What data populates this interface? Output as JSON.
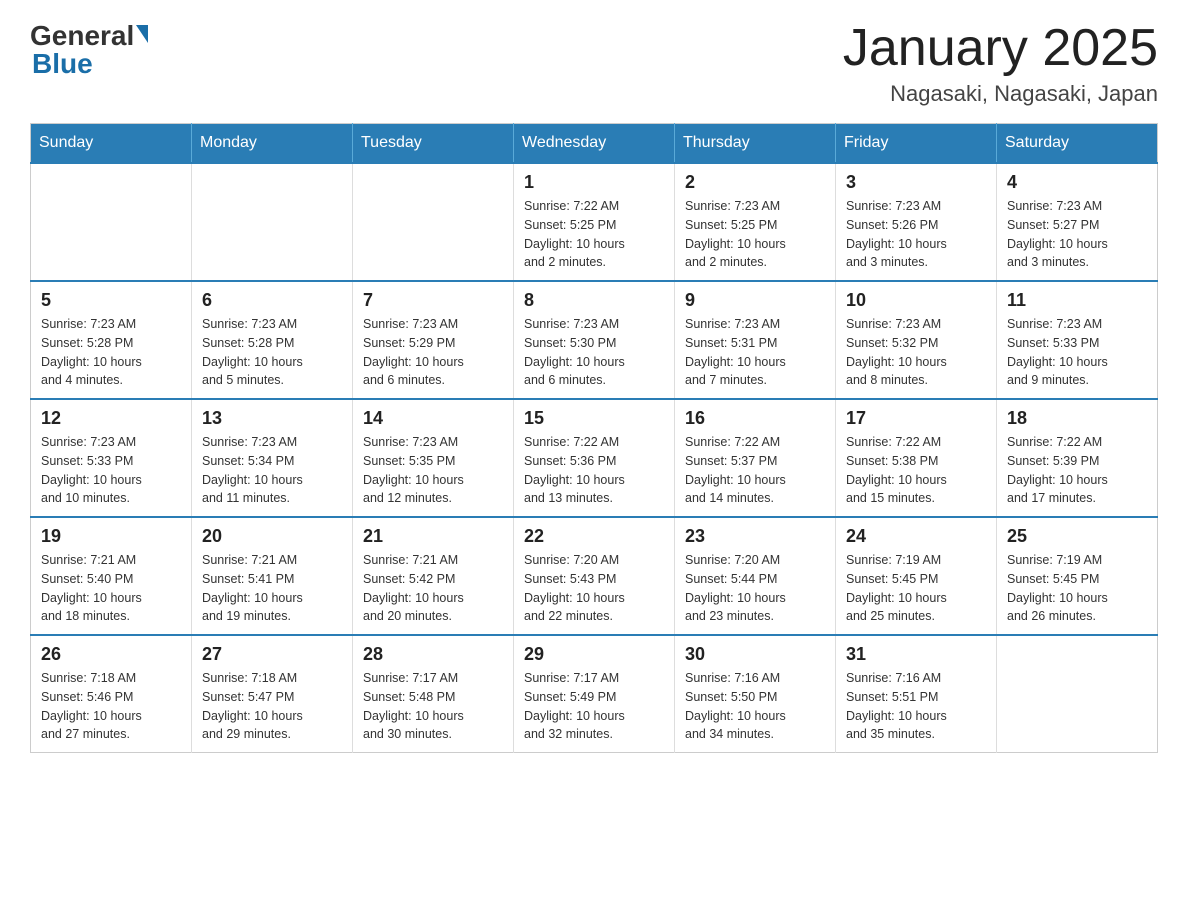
{
  "header": {
    "logo_general": "General",
    "logo_blue": "Blue",
    "month_title": "January 2025",
    "location": "Nagasaki, Nagasaki, Japan"
  },
  "days_of_week": [
    "Sunday",
    "Monday",
    "Tuesday",
    "Wednesday",
    "Thursday",
    "Friday",
    "Saturday"
  ],
  "weeks": [
    [
      {
        "day": "",
        "info": ""
      },
      {
        "day": "",
        "info": ""
      },
      {
        "day": "",
        "info": ""
      },
      {
        "day": "1",
        "info": "Sunrise: 7:22 AM\nSunset: 5:25 PM\nDaylight: 10 hours\nand 2 minutes."
      },
      {
        "day": "2",
        "info": "Sunrise: 7:23 AM\nSunset: 5:25 PM\nDaylight: 10 hours\nand 2 minutes."
      },
      {
        "day": "3",
        "info": "Sunrise: 7:23 AM\nSunset: 5:26 PM\nDaylight: 10 hours\nand 3 minutes."
      },
      {
        "day": "4",
        "info": "Sunrise: 7:23 AM\nSunset: 5:27 PM\nDaylight: 10 hours\nand 3 minutes."
      }
    ],
    [
      {
        "day": "5",
        "info": "Sunrise: 7:23 AM\nSunset: 5:28 PM\nDaylight: 10 hours\nand 4 minutes."
      },
      {
        "day": "6",
        "info": "Sunrise: 7:23 AM\nSunset: 5:28 PM\nDaylight: 10 hours\nand 5 minutes."
      },
      {
        "day": "7",
        "info": "Sunrise: 7:23 AM\nSunset: 5:29 PM\nDaylight: 10 hours\nand 6 minutes."
      },
      {
        "day": "8",
        "info": "Sunrise: 7:23 AM\nSunset: 5:30 PM\nDaylight: 10 hours\nand 6 minutes."
      },
      {
        "day": "9",
        "info": "Sunrise: 7:23 AM\nSunset: 5:31 PM\nDaylight: 10 hours\nand 7 minutes."
      },
      {
        "day": "10",
        "info": "Sunrise: 7:23 AM\nSunset: 5:32 PM\nDaylight: 10 hours\nand 8 minutes."
      },
      {
        "day": "11",
        "info": "Sunrise: 7:23 AM\nSunset: 5:33 PM\nDaylight: 10 hours\nand 9 minutes."
      }
    ],
    [
      {
        "day": "12",
        "info": "Sunrise: 7:23 AM\nSunset: 5:33 PM\nDaylight: 10 hours\nand 10 minutes."
      },
      {
        "day": "13",
        "info": "Sunrise: 7:23 AM\nSunset: 5:34 PM\nDaylight: 10 hours\nand 11 minutes."
      },
      {
        "day": "14",
        "info": "Sunrise: 7:23 AM\nSunset: 5:35 PM\nDaylight: 10 hours\nand 12 minutes."
      },
      {
        "day": "15",
        "info": "Sunrise: 7:22 AM\nSunset: 5:36 PM\nDaylight: 10 hours\nand 13 minutes."
      },
      {
        "day": "16",
        "info": "Sunrise: 7:22 AM\nSunset: 5:37 PM\nDaylight: 10 hours\nand 14 minutes."
      },
      {
        "day": "17",
        "info": "Sunrise: 7:22 AM\nSunset: 5:38 PM\nDaylight: 10 hours\nand 15 minutes."
      },
      {
        "day": "18",
        "info": "Sunrise: 7:22 AM\nSunset: 5:39 PM\nDaylight: 10 hours\nand 17 minutes."
      }
    ],
    [
      {
        "day": "19",
        "info": "Sunrise: 7:21 AM\nSunset: 5:40 PM\nDaylight: 10 hours\nand 18 minutes."
      },
      {
        "day": "20",
        "info": "Sunrise: 7:21 AM\nSunset: 5:41 PM\nDaylight: 10 hours\nand 19 minutes."
      },
      {
        "day": "21",
        "info": "Sunrise: 7:21 AM\nSunset: 5:42 PM\nDaylight: 10 hours\nand 20 minutes."
      },
      {
        "day": "22",
        "info": "Sunrise: 7:20 AM\nSunset: 5:43 PM\nDaylight: 10 hours\nand 22 minutes."
      },
      {
        "day": "23",
        "info": "Sunrise: 7:20 AM\nSunset: 5:44 PM\nDaylight: 10 hours\nand 23 minutes."
      },
      {
        "day": "24",
        "info": "Sunrise: 7:19 AM\nSunset: 5:45 PM\nDaylight: 10 hours\nand 25 minutes."
      },
      {
        "day": "25",
        "info": "Sunrise: 7:19 AM\nSunset: 5:45 PM\nDaylight: 10 hours\nand 26 minutes."
      }
    ],
    [
      {
        "day": "26",
        "info": "Sunrise: 7:18 AM\nSunset: 5:46 PM\nDaylight: 10 hours\nand 27 minutes."
      },
      {
        "day": "27",
        "info": "Sunrise: 7:18 AM\nSunset: 5:47 PM\nDaylight: 10 hours\nand 29 minutes."
      },
      {
        "day": "28",
        "info": "Sunrise: 7:17 AM\nSunset: 5:48 PM\nDaylight: 10 hours\nand 30 minutes."
      },
      {
        "day": "29",
        "info": "Sunrise: 7:17 AM\nSunset: 5:49 PM\nDaylight: 10 hours\nand 32 minutes."
      },
      {
        "day": "30",
        "info": "Sunrise: 7:16 AM\nSunset: 5:50 PM\nDaylight: 10 hours\nand 34 minutes."
      },
      {
        "day": "31",
        "info": "Sunrise: 7:16 AM\nSunset: 5:51 PM\nDaylight: 10 hours\nand 35 minutes."
      },
      {
        "day": "",
        "info": ""
      }
    ]
  ]
}
